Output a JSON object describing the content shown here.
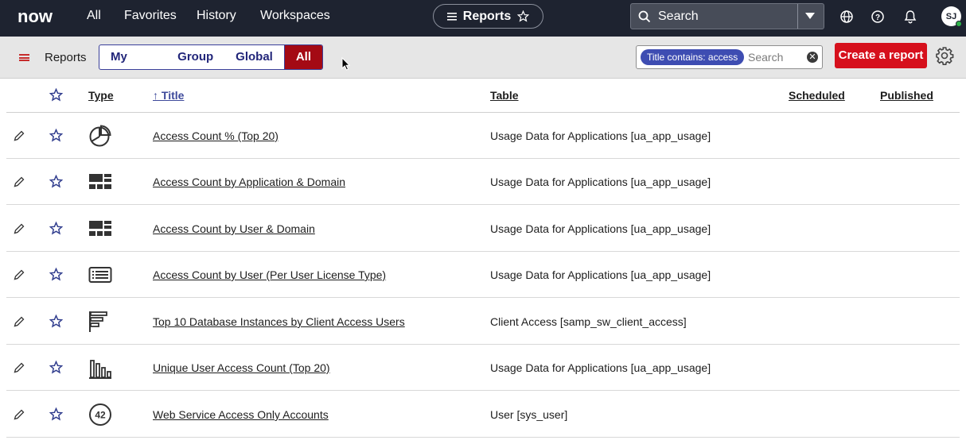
{
  "topnav": {
    "logo": "now",
    "links": [
      "All",
      "Favorites",
      "History",
      "Workspaces"
    ],
    "app_pill": "Reports",
    "search_label": "Search",
    "avatar": "SJ"
  },
  "toolbar": {
    "title": "Reports",
    "segments": [
      "My reports",
      "Group",
      "Global",
      "All"
    ],
    "active_segment": "All",
    "filter_chip": "Title contains: access",
    "search_placeholder": "Search",
    "create_label": "Create a report"
  },
  "table": {
    "headers": {
      "type": "Type",
      "title": "↑ Title",
      "table": "Table",
      "scheduled": "Scheduled",
      "published": "Published"
    },
    "rows": [
      {
        "icon": "pie-chart-icon",
        "title": "Access Count % (Top 20)",
        "table": "Usage Data for Applications [ua_app_usage]"
      },
      {
        "icon": "dashboard-icon",
        "title": "Access Count by Application & Domain",
        "table": "Usage Data for Applications [ua_app_usage]"
      },
      {
        "icon": "dashboard-icon",
        "title": "Access Count by User & Domain",
        "table": "Usage Data for Applications [ua_app_usage]"
      },
      {
        "icon": "list-report-icon",
        "title": "Access Count by User (Per User License Type)",
        "table": "Usage Data for Applications [ua_app_usage]"
      },
      {
        "icon": "horizontal-bar-icon",
        "title": "Top 10 Database Instances by Client Access Users",
        "table": "Client Access [samp_sw_client_access]"
      },
      {
        "icon": "vertical-bar-icon",
        "title": "Unique User Access Count (Top 20)",
        "table": "Usage Data for Applications [ua_app_usage]"
      },
      {
        "icon": "single-score-icon",
        "title": "Web Service Access Only Accounts",
        "table": "User [sys_user]",
        "score_label": "42"
      }
    ]
  },
  "colors": {
    "nav_bg": "#1e2330",
    "accent_red": "#d6101c",
    "active_segment": "#a40a14",
    "chip": "#3e4db2"
  }
}
